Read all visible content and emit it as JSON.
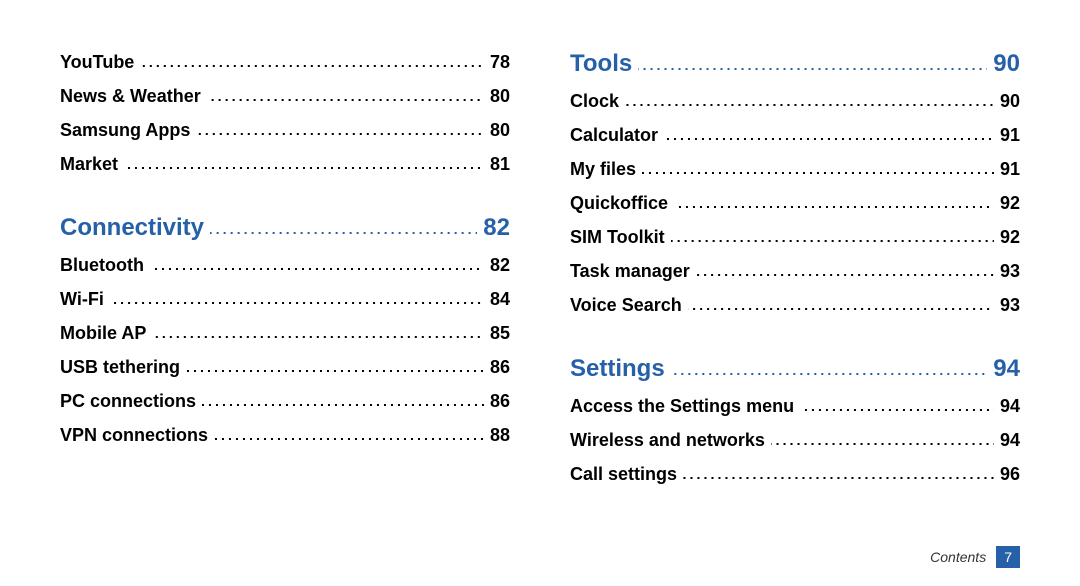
{
  "left_column": [
    {
      "type": "item",
      "label": "YouTube",
      "page": "78"
    },
    {
      "type": "item",
      "label": "News & Weather",
      "page": "80"
    },
    {
      "type": "item",
      "label": "Samsung Apps",
      "page": "80"
    },
    {
      "type": "item",
      "label": "Market",
      "page": "81"
    },
    {
      "type": "heading",
      "label": "Connectivity",
      "page": "82"
    },
    {
      "type": "item",
      "label": "Bluetooth",
      "page": "82"
    },
    {
      "type": "item",
      "label": "Wi-Fi",
      "page": "84"
    },
    {
      "type": "item",
      "label": "Mobile AP",
      "page": "85"
    },
    {
      "type": "item",
      "label": "USB tethering",
      "page": "86"
    },
    {
      "type": "item",
      "label": "PC connections",
      "page": "86"
    },
    {
      "type": "item",
      "label": "VPN connections",
      "page": "88"
    }
  ],
  "right_column": [
    {
      "type": "heading",
      "label": "Tools",
      "page": "90"
    },
    {
      "type": "item",
      "label": "Clock",
      "page": "90"
    },
    {
      "type": "item",
      "label": "Calculator",
      "page": "91"
    },
    {
      "type": "item",
      "label": "My files",
      "page": "91"
    },
    {
      "type": "item",
      "label": "Quickoffice",
      "page": "92"
    },
    {
      "type": "item",
      "label": "SIM Toolkit",
      "page": "92"
    },
    {
      "type": "item",
      "label": "Task manager",
      "page": "93"
    },
    {
      "type": "item",
      "label": "Voice Search",
      "page": "93"
    },
    {
      "type": "heading",
      "label": "Settings",
      "page": "94"
    },
    {
      "type": "item",
      "label": "Access the Settings menu",
      "page": "94"
    },
    {
      "type": "item",
      "label": "Wireless and networks",
      "page": "94"
    },
    {
      "type": "item",
      "label": "Call settings",
      "page": "96"
    }
  ],
  "footer": {
    "label": "Contents",
    "page": "7"
  }
}
